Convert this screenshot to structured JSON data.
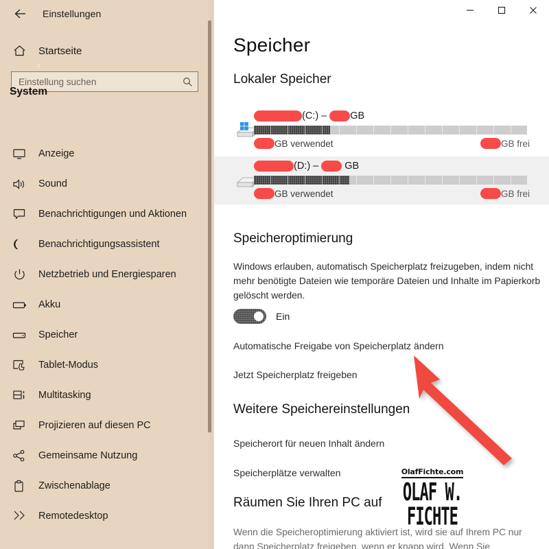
{
  "window": {
    "title": "Einstellungen",
    "controls": {
      "minimize": "–",
      "maximize": "□",
      "close": "✕"
    }
  },
  "sidebar": {
    "back_icon": "back-arrow-icon",
    "home": {
      "label": "Startseite",
      "icon": "home-icon"
    },
    "search": {
      "placeholder": "Einstellung suchen",
      "value": "",
      "icon": "search-icon"
    },
    "category": "System",
    "items": [
      {
        "label": "Anzeige",
        "icon": "display-icon"
      },
      {
        "label": "Sound",
        "icon": "speaker-icon"
      },
      {
        "label": "Benachrichtigungen und Aktionen",
        "icon": "notification-icon"
      },
      {
        "label": "Benachrichtigungsassistent",
        "icon": "moon-icon"
      },
      {
        "label": "Netzbetrieb und Energiesparen",
        "icon": "power-icon"
      },
      {
        "label": "Akku",
        "icon": "battery-icon"
      },
      {
        "label": "Speicher",
        "icon": "storage-icon"
      },
      {
        "label": "Tablet-Modus",
        "icon": "tablet-icon"
      },
      {
        "label": "Multitasking",
        "icon": "multitasking-icon"
      },
      {
        "label": "Projizieren auf diesen PC",
        "icon": "project-icon"
      },
      {
        "label": "Gemeinsame Nutzung",
        "icon": "share-icon"
      },
      {
        "label": "Zwischenablage",
        "icon": "clipboard-icon"
      },
      {
        "label": "Remotedesktop",
        "icon": "remote-desktop-icon"
      }
    ]
  },
  "main": {
    "page_title": "Speicher",
    "local_storage_heading": "Lokaler Speicher",
    "drives": [
      {
        "name_redacted": true,
        "letter": "(C:)",
        "separator": "–",
        "size_unit": "GB",
        "used_unit": "GB verwendet",
        "free_unit": "GB frei",
        "fill_percent": 28,
        "icon": "drive-windows-icon",
        "highlighted": false
      },
      {
        "name_redacted": true,
        "letter": "(D:)",
        "separator": "–",
        "size_unit": "GB",
        "used_unit": "GB verwendet",
        "free_unit": "GB frei",
        "fill_percent": 35,
        "icon": "drive-icon",
        "highlighted": true
      }
    ],
    "storage_sense": {
      "heading": "Speicheroptimierung",
      "description": "Windows erlauben, automatisch Speicherplatz freizugeben, indem nicht mehr benötigte Dateien wie temporäre Dateien und Inhalte im Papierkorb gelöscht werden.",
      "toggle_state": "Ein",
      "link_change_auto": "Automatische Freigabe von Speicherplatz ändern",
      "link_free_now": "Jetzt Speicherplatz freigeben"
    },
    "more_settings": {
      "heading": "Weitere Speichereinstellungen",
      "link_change_location": "Speicherort für neuen Inhalt ändern",
      "link_manage_spaces": "Speicherplätze verwalten"
    },
    "cleanup": {
      "heading": "Räumen Sie Ihren PC auf",
      "description": "Wenn die Speicheroptimierung aktiviert ist, wird sie auf Ihrem PC nur dann Speicherplatz freigeben, wenn er knapp wird. Wenn Sie"
    }
  },
  "watermark": {
    "top_text": "OlafFichte.com",
    "main_text": "OLAF W. FICHTE"
  },
  "colors": {
    "sidebar_bg": "#e8d5bf",
    "redaction": "#f94a4a",
    "arrow": "#f04a3f",
    "bar_used": "#3a3a3a",
    "bar_track": "#cdcdcd"
  }
}
